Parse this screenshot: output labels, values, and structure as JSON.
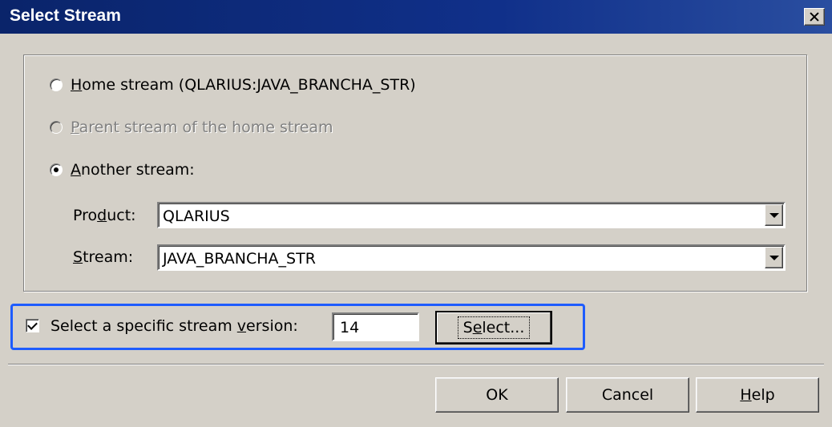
{
  "window": {
    "title": "Select Stream"
  },
  "options": {
    "home": {
      "prefix": "H",
      "rest": "ome stream (QLARIUS:JAVA_BRANCHA_STR)"
    },
    "parent": {
      "prefix": "P",
      "rest": "arent stream of the home stream"
    },
    "another": {
      "prefix": "A",
      "rest": "nother stream:"
    }
  },
  "product": {
    "label_pre": "Pro",
    "label_ul": "d",
    "label_post": "uct:",
    "value": "QLARIUS"
  },
  "stream": {
    "label_ul": "S",
    "label_post": "tream:",
    "value": "JAVA_BRANCHA_STR"
  },
  "version": {
    "label_pre": "Select a specific stream ",
    "label_ul": "v",
    "label_post": "ersion:",
    "value": "14",
    "select_pre": "S",
    "select_ul": "e",
    "select_post": "lect...",
    "checked": true
  },
  "buttons": {
    "ok": "OK",
    "cancel": "Cancel",
    "help_ul": "H",
    "help_post": "elp"
  },
  "colors": {
    "titlebar": "#0a246a",
    "highlight": "#1e5cff",
    "face": "#d4d0c8"
  },
  "icons": {
    "close": "close-icon",
    "dropdown": "chevron-down-icon"
  }
}
